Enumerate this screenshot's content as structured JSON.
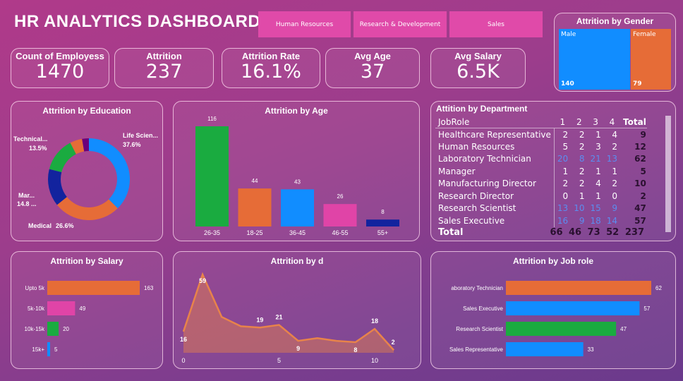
{
  "header": {
    "title": "HR ANALYTICS DASHBOARD"
  },
  "slicers": [
    "Human Resources",
    "Research & Development",
    "Sales"
  ],
  "kpis": [
    {
      "label": "Count of Employess",
      "value": "1470"
    },
    {
      "label": "Attrition",
      "value": "237"
    },
    {
      "label": "Attrition Rate",
      "value": "16.1%"
    },
    {
      "label": "Avg Age",
      "value": "37"
    },
    {
      "label": "Avg Salary",
      "value": "6.5K"
    }
  ],
  "gender": {
    "title": "Attrition by Gender",
    "items": [
      {
        "label": "Male",
        "value": "140",
        "color": "#118dff"
      },
      {
        "label": "Female",
        "value": "79",
        "color": "#e66c37"
      }
    ]
  },
  "chart_data": [
    {
      "type": "pie",
      "title": "Attrition by Education",
      "donut": true,
      "slices": [
        {
          "label": "Life Scien...",
          "pct_label": "37.6%",
          "value": 37.6,
          "color": "#118dff"
        },
        {
          "label": "Medical",
          "pct_label": "26.6%",
          "value": 26.6,
          "color": "#e66c37"
        },
        {
          "label": "Mar...",
          "pct_label": "14.8 ...",
          "value": 14.8,
          "color": "#12239e"
        },
        {
          "label": "Technical...",
          "pct_label": "13.5%",
          "value": 13.5,
          "color": "#1aab40"
        },
        {
          "value": 4.8,
          "color": "#e66c37"
        },
        {
          "value": 2.7,
          "color": "#6b007b"
        }
      ]
    },
    {
      "type": "bar",
      "title": "Attrition by Age",
      "categories": [
        "26-35",
        "18-25",
        "36-45",
        "46-55",
        "55+"
      ],
      "values": [
        116,
        44,
        43,
        26,
        8
      ],
      "colors": [
        "#1aab40",
        "#e66c37",
        "#118dff",
        "#e044a7",
        "#12239e"
      ]
    },
    {
      "type": "bar",
      "orientation": "horizontal",
      "title": "Attrition by Salary",
      "categories": [
        "Upto 5k",
        "5k-10k",
        "10k-15k",
        "15k+"
      ],
      "values": [
        163,
        49,
        20,
        5
      ],
      "colors": [
        "#e66c37",
        "#e044a7",
        "#1aab40",
        "#118dff"
      ]
    },
    {
      "type": "area",
      "title": "Attrition by d",
      "x": [
        0,
        1,
        2,
        3,
        4,
        5,
        6,
        7,
        8,
        9,
        10,
        11
      ],
      "values": [
        16,
        59,
        27,
        20,
        19,
        21,
        9,
        11,
        9,
        8,
        18,
        2
      ],
      "data_labels": {
        "0": "16",
        "1": "59",
        "4": "19",
        "5": "21",
        "6": "9",
        "9": "8",
        "10": "18",
        "11": "2"
      },
      "xticks": [
        0,
        5,
        10
      ],
      "color": "#e8834a"
    },
    {
      "type": "bar",
      "orientation": "horizontal",
      "title": "Attrition by Job role",
      "categories": [
        "aboratory Technician",
        "Sales Executive",
        "Research Scientist",
        "Sales Representative"
      ],
      "values": [
        62,
        57,
        47,
        33
      ],
      "colors": [
        "#e66c37",
        "#118dff",
        "#1aab40",
        "#118dff"
      ]
    }
  ],
  "department": {
    "title": "Attition by Department",
    "columns": [
      "JobRole",
      "1",
      "2",
      "3",
      "4",
      "Total"
    ],
    "rows": [
      [
        "Healthcare Representative",
        "2",
        "2",
        "1",
        "4",
        "9"
      ],
      [
        "Human Resources",
        "5",
        "2",
        "3",
        "2",
        "12"
      ],
      [
        "Laboratory Technician",
        "20",
        "8",
        "21",
        "13",
        "62"
      ],
      [
        "Manager",
        "1",
        "2",
        "1",
        "1",
        "5"
      ],
      [
        "Manufacturing Director",
        "2",
        "2",
        "4",
        "2",
        "10"
      ],
      [
        "Research Director",
        "0",
        "1",
        "1",
        "0",
        "2"
      ],
      [
        "Research Scientist",
        "13",
        "10",
        "15",
        "9",
        "47"
      ],
      [
        "Sales Executive",
        "16",
        "9",
        "18",
        "14",
        "57"
      ]
    ],
    "total": [
      "Total",
      "66",
      "46",
      "73",
      "52",
      "237"
    ]
  }
}
